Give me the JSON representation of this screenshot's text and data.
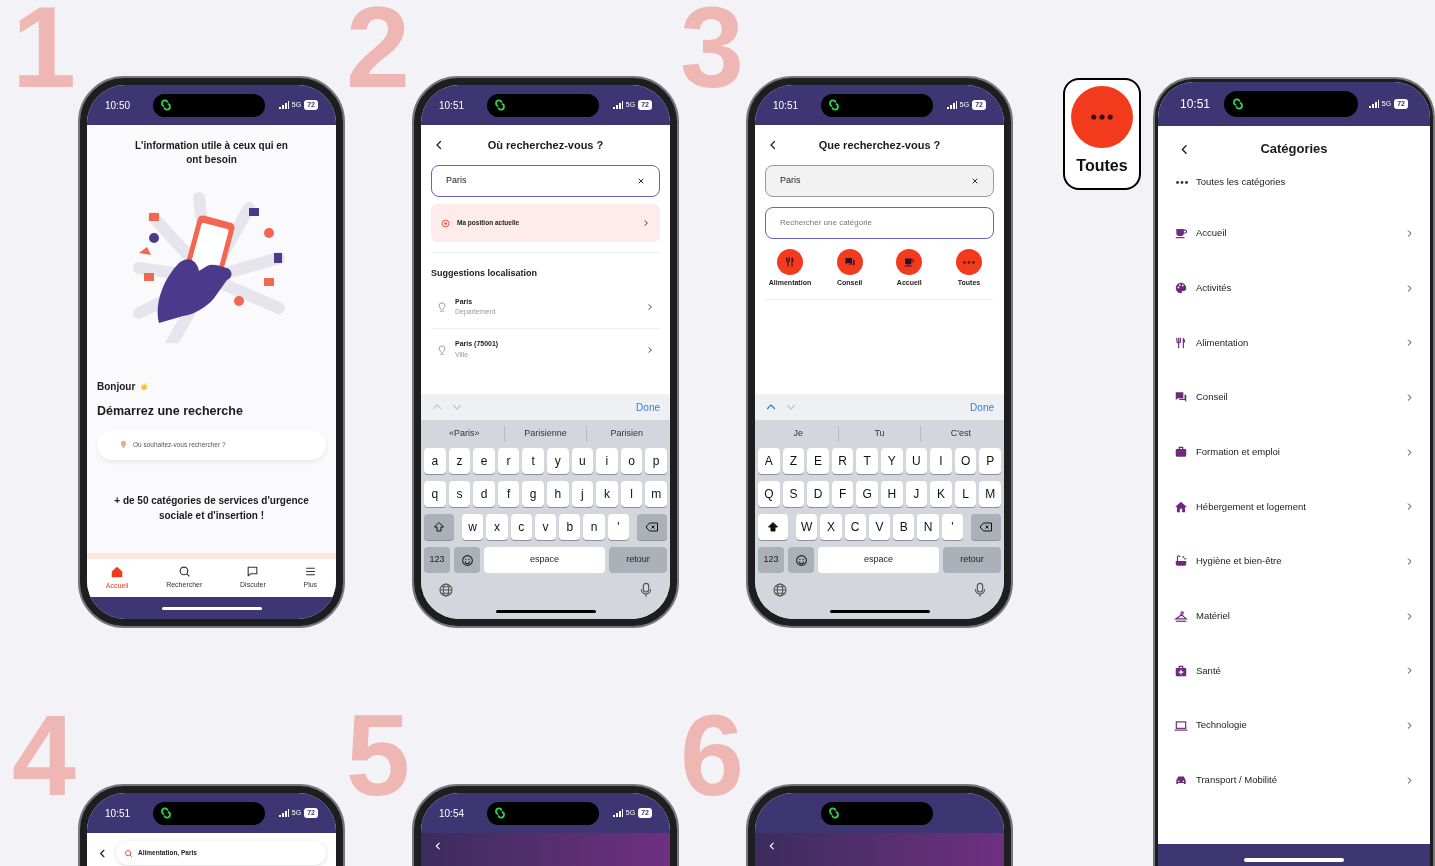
{
  "phones": [
    {
      "kind": "home",
      "marker": "1",
      "status": {
        "time": "10:50",
        "network": "5G",
        "battery": "72"
      },
      "headline": "L'information utile à ceux qui en ont besoin",
      "greeting": "Bonjour",
      "heading": "Démarrez une recherche",
      "search": {
        "placeholder": "Où souhaitez-vous rechercher ?"
      },
      "tagline": "+ de 50 catégories de services d'urgence sociale et d'insertion !",
      "tabs": [
        {
          "label": "Accueil",
          "selected": true
        },
        {
          "label": "Rechercher",
          "selected": false
        },
        {
          "label": "Discuter",
          "selected": false
        },
        {
          "label": "Plus",
          "selected": false
        }
      ]
    },
    {
      "kind": "location_search",
      "marker": "2",
      "status": {
        "time": "10:51",
        "network": "5G",
        "battery": "72"
      },
      "title": "Où recherchez-vous ?",
      "field": {
        "value": "Paris",
        "focused": true
      },
      "current_position": "Ma position actuelle",
      "section": "Suggestions localisation",
      "suggestions": [
        {
          "name": "Paris",
          "type": "Département"
        },
        {
          "name": "Paris (75001)",
          "type": "Ville"
        }
      ],
      "keyboard": {
        "prev_enabled": false,
        "done": "Done",
        "suggestions": [
          "«Paris»",
          "Parisienne",
          "Parisien"
        ],
        "rows": [
          [
            "a",
            "z",
            "e",
            "r",
            "t",
            "y",
            "u",
            "i",
            "o",
            "p"
          ],
          [
            "q",
            "s",
            "d",
            "f",
            "g",
            "h",
            "j",
            "k",
            "l",
            "m"
          ],
          [
            "w",
            "x",
            "c",
            "v",
            "b",
            "n",
            "'"
          ]
        ],
        "shift_on": false,
        "numbers": "123",
        "space": "espace",
        "return": "retour"
      }
    },
    {
      "kind": "category_search",
      "marker": "3",
      "status": {
        "time": "10:51",
        "network": "5G",
        "battery": "72"
      },
      "title": "Que recherchez-vous ?",
      "field": {
        "value": "Paris",
        "focused": false
      },
      "category_field": {
        "placeholder": "Rechercher une catégorie",
        "focused": true
      },
      "categories": [
        "Alimentation",
        "Conseil",
        "Accueil",
        "Toutes"
      ],
      "keyboard": {
        "prev_enabled": true,
        "done": "Done",
        "suggestions": [
          "Je",
          "Tu",
          "C'est"
        ],
        "rows": [
          [
            "A",
            "Z",
            "E",
            "R",
            "T",
            "Y",
            "U",
            "I",
            "O",
            "P"
          ],
          [
            "Q",
            "S",
            "D",
            "F",
            "G",
            "H",
            "J",
            "K",
            "L",
            "M"
          ],
          [
            "W",
            "X",
            "C",
            "V",
            "B",
            "N",
            "'"
          ]
        ],
        "shift_on": true,
        "numbers": "123",
        "space": "espace",
        "return": "retour"
      }
    },
    {
      "kind": "results",
      "marker": "4",
      "status": {
        "time": "10:51",
        "network": "5G",
        "battery": "72"
      },
      "search_value": "Alimentation, Paris"
    },
    {
      "kind": "detail",
      "marker": "5",
      "status": {
        "time": "10:54",
        "network": "5G",
        "battery": "72"
      }
    },
    {
      "kind": "detail",
      "marker": "6"
    }
  ],
  "callout": {
    "label": "Toutes"
  },
  "categories_phone": {
    "status": {
      "time": "10:51",
      "network": "5G",
      "battery": "72"
    },
    "title": "Catégories",
    "all_label": "Toutes les catégories",
    "items": [
      "Accueil",
      "Activités",
      "Alimentation",
      "Conseil",
      "Formation et emploi",
      "Hébergement et logement",
      "Hygiène et bien-être",
      "Matériel",
      "Santé",
      "Technologie",
      "Transport / Mobilité"
    ]
  }
}
